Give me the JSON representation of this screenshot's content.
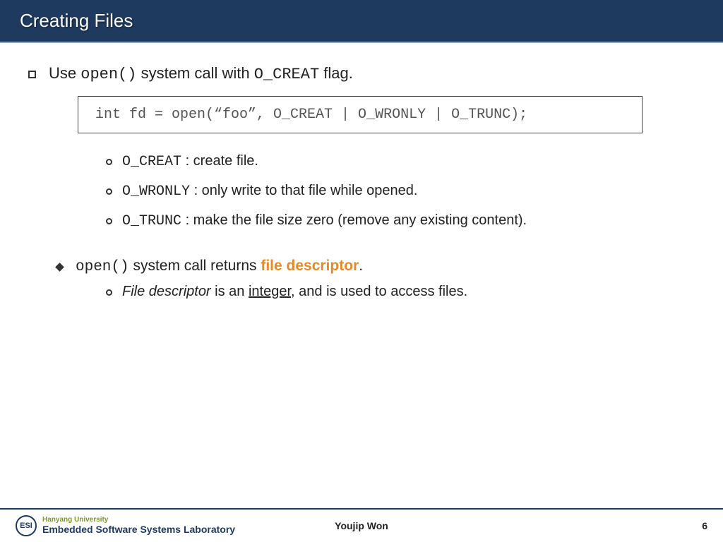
{
  "header": {
    "title": "Creating Files"
  },
  "main": {
    "bullet1_pre": "Use ",
    "bullet1_code1": "open()",
    "bullet1_mid": " system call with ",
    "bullet1_code2": "O_CREAT",
    "bullet1_post": " flag.",
    "codebox": "int fd = open(“foo”, O_CREAT | O_WRONLY | O_TRUNC);",
    "flags": [
      {
        "code": "O_CREAT",
        "desc": " : create file."
      },
      {
        "code": "O_WRONLY",
        "desc": " : only write to that file while opened."
      },
      {
        "code": "O_TRUNC",
        "desc": " : make the file size zero (remove any existing content)."
      }
    ],
    "bullet2_code": "open()",
    "bullet2_mid": " system call returns ",
    "bullet2_highlight": "file descriptor",
    "bullet2_post": ".",
    "sub2_italic": "File descriptor",
    "sub2_mid": " is an ",
    "sub2_underline": "integer",
    "sub2_post": ", and is used to access files."
  },
  "footer": {
    "university": "Hanyang University",
    "lab": "Embedded Software Systems Laboratory",
    "author": "Youjip Won",
    "page": "6",
    "badge": "ESI"
  }
}
